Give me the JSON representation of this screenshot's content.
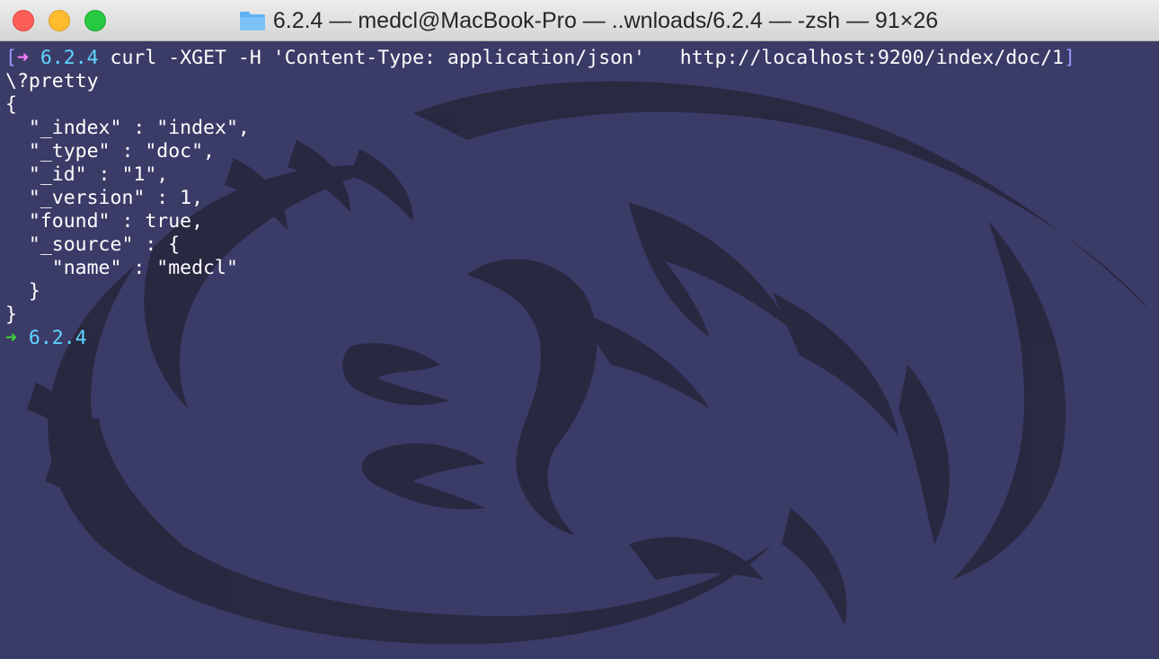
{
  "window": {
    "title": "6.2.4 — medcl@MacBook-Pro — ..wnloads/6.2.4 — -zsh — 91×26"
  },
  "icons": {
    "folder": "folder-icon",
    "prompt_arrow": "arrow-right-icon"
  },
  "colors": {
    "background": "#3b3b68",
    "prompt_arrow_previous": "#ff7fff",
    "prompt_arrow_current": "#3ad33a",
    "directory": "#5fd7ff",
    "text": "#ffffff"
  },
  "terminal": {
    "prompt1": {
      "bracket_left": "[",
      "arrow": "➜",
      "dir": "6.2.4",
      "command": " curl -XGET -H 'Content-Type: application/json'   http://localhost:9200/index/doc/1",
      "bracket_right": "]"
    },
    "output": [
      "\\?pretty",
      "{",
      "  \"_index\" : \"index\",",
      "  \"_type\" : \"doc\",",
      "  \"_id\" : \"1\",",
      "  \"_version\" : 1,",
      "  \"found\" : true,",
      "  \"_source\" : {",
      "    \"name\" : \"medcl\"",
      "  }",
      "}"
    ],
    "prompt2": {
      "arrow": "➜",
      "dir": "6.2.4"
    }
  }
}
